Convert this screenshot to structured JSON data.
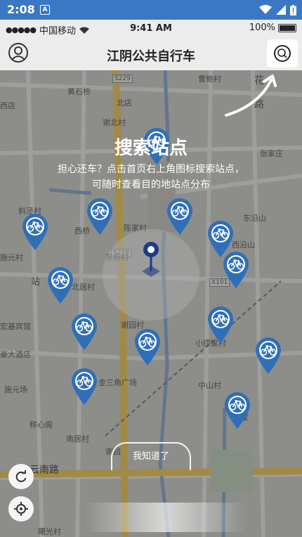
{
  "android_status": {
    "time": "2:08",
    "app_icon_letter": "A"
  },
  "ios_status": {
    "carrier": "中国移动",
    "time": "9:41 AM",
    "battery": "100%"
  },
  "nav": {
    "title": "江阴公共自行车"
  },
  "guide": {
    "title": "搜索站点",
    "line1": "担心还车？点击首页右上角图标搜索站点，",
    "line2": "可随时查看目的地站点分布",
    "button": "我知道了"
  },
  "map": {
    "labels": [
      {
        "id": "曹鲍村",
        "text": "曹鲍村"
      },
      {
        "id": "花",
        "text": "花"
      },
      {
        "id": "路",
        "text": "路"
      },
      {
        "id": "黄石桥",
        "text": "黄石桥"
      },
      {
        "id": "西店",
        "text": "西店"
      },
      {
        "id": "北店",
        "text": "北店"
      },
      {
        "id": "谢北村",
        "text": "谢北村"
      },
      {
        "id": "张家庄",
        "text": "张家庄"
      },
      {
        "id": "斜泾村",
        "text": "斜泾村"
      },
      {
        "id": "西桥",
        "text": "西桥"
      },
      {
        "id": "陈家村",
        "text": "陈家村"
      },
      {
        "id": "东沿山",
        "text": "东沿山"
      },
      {
        "id": "西沿山",
        "text": "西沿山"
      },
      {
        "id": "施元村",
        "text": "施元村"
      },
      {
        "id": "东桥村",
        "text": "东桥村"
      },
      {
        "id": "站",
        "text": "站"
      },
      {
        "id": "北居村",
        "text": "北居村"
      },
      {
        "id": "宏基宾馆",
        "text": "宏基宾馆"
      },
      {
        "id": "谢园村",
        "text": "谢园村"
      },
      {
        "id": "小缪家村",
        "text": "小缪家村"
      },
      {
        "id": "豪大酒店",
        "text": "豪大酒店"
      },
      {
        "id": "金三角广场",
        "text": "金三角广场"
      },
      {
        "id": "中山村",
        "text": "中山村"
      },
      {
        "id": "施元场",
        "text": "施元场"
      },
      {
        "id": "阚家",
        "text": "阚家"
      },
      {
        "id": "称心阁",
        "text": "称心阁"
      },
      {
        "id": "南居村",
        "text": "南居村"
      },
      {
        "id": "谢园",
        "text": "谢园"
      },
      {
        "id": "云南路",
        "text": "云南路"
      },
      {
        "id": "曙光村",
        "text": "曙光村"
      }
    ],
    "road_tags": [
      "S229",
      "S229",
      "X101"
    ],
    "station_count_note": ""
  },
  "colors": {
    "pin_blue": "#2f6fb8",
    "android_bar": "#3a78c6",
    "nav_bg": "#ececec"
  },
  "icons": [
    "avatar-icon",
    "search-icon",
    "refresh-icon",
    "locate-icon",
    "bike-station-icon",
    "current-location-pin-icon",
    "wifi-icon",
    "battery-icon"
  ]
}
